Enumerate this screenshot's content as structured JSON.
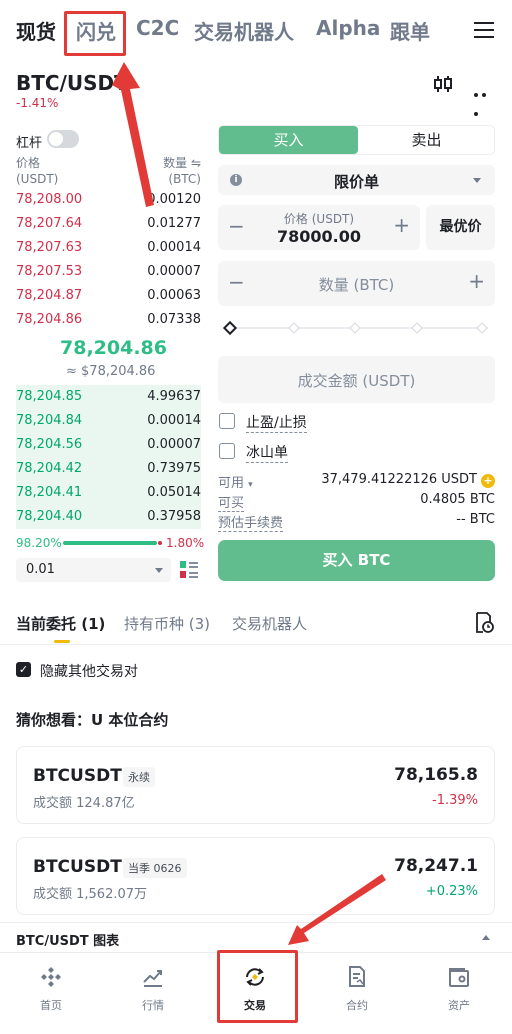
{
  "topnav": {
    "tabs": [
      {
        "label": "现货",
        "active": true
      },
      {
        "label": "闪兑",
        "active": false,
        "highlighted": true
      },
      {
        "label": "C2C",
        "active": false
      },
      {
        "label": "交易机器人",
        "active": false
      },
      {
        "label": "Alpha",
        "active": false
      },
      {
        "label": "跟单",
        "active": false
      }
    ],
    "menu_icon": "hamburger-menu-icon"
  },
  "pair": {
    "symbol": "BTC/USDT",
    "change": "-1.41%",
    "icons": [
      "candlestick-chart-icon",
      "more-dots-icon"
    ]
  },
  "leverage": {
    "label": "杠杆",
    "enabled": false
  },
  "orderbook": {
    "price_header": "价格",
    "price_unit": "(USDT)",
    "qty_header": "数量 ⇋",
    "qty_unit": "(BTC)",
    "asks": [
      {
        "price": "78,208.00",
        "qty": "0.00120",
        "depth": 0.0
      },
      {
        "price": "78,207.64",
        "qty": "0.01277",
        "depth": 0.0
      },
      {
        "price": "78,207.63",
        "qty": "0.00014",
        "depth": 0.0
      },
      {
        "price": "78,207.53",
        "qty": "0.00007",
        "depth": 0.0
      },
      {
        "price": "78,204.87",
        "qty": "0.00063",
        "depth": 0.0
      },
      {
        "price": "78,204.86",
        "qty": "0.07338",
        "depth": 0.0
      }
    ],
    "mid_price": "78,204.86",
    "mid_fiat": "≈ $78,204.86",
    "bids": [
      {
        "price": "78,204.85",
        "qty": "4.99637",
        "depth": 1.0
      },
      {
        "price": "78,204.84",
        "qty": "0.00014",
        "depth": 1.0
      },
      {
        "price": "78,204.56",
        "qty": "0.00007",
        "depth": 1.0
      },
      {
        "price": "78,204.42",
        "qty": "0.73975",
        "depth": 1.0
      },
      {
        "price": "78,204.41",
        "qty": "0.05014",
        "depth": 1.0
      },
      {
        "price": "78,204.40",
        "qty": "0.37958",
        "depth": 1.0
      }
    ],
    "buy_ratio": "98.20%",
    "sell_ratio": "1.80%",
    "precision": "0.01",
    "layout_icon": "orderbook-layout-icon"
  },
  "order_form": {
    "buy_tab": "买入",
    "sell_tab": "卖出",
    "order_type": "限价单",
    "price_label": "价格 (USDT)",
    "price_value": "78000.00",
    "best_price": "最优价",
    "qty_placeholder": "数量 (BTC)",
    "total_placeholder": "成交金额 (USDT)",
    "tp_sl": "止盈/止损",
    "iceberg": "冰山单",
    "available_label": "可用",
    "available_value": "37,479.41222126 USDT",
    "can_buy_label": "可买",
    "can_buy_value": "0.4805 BTC",
    "fee_label": "预估手续费",
    "fee_value": "-- BTC",
    "submit": "买入 BTC"
  },
  "orders": {
    "tabs": [
      "当前委托 (1)",
      "持有币种 (3)",
      "交易机器人"
    ],
    "hide_others": "隐藏其他交易对",
    "guess": "猜你想看：U 本位合约",
    "cards": [
      {
        "symbol": "BTCUSDT",
        "tag": "永续",
        "volume": "成交额 124.87亿",
        "price": "78,165.8",
        "change": "-1.39%",
        "change_color": "#cf304a"
      },
      {
        "symbol": "BTCUSDT",
        "tag": "当季 0626",
        "volume": "成交额 1,562.07万",
        "price": "78,247.1",
        "change": "+0.23%",
        "change_color": "#03a66d"
      }
    ],
    "chart_toggle": "BTC/USDT 图表"
  },
  "bottomnav": [
    {
      "label": "首页",
      "icon": "home-icon",
      "active": false
    },
    {
      "label": "行情",
      "icon": "markets-icon",
      "active": false
    },
    {
      "label": "交易",
      "icon": "trade-icon",
      "active": true
    },
    {
      "label": "合约",
      "icon": "futures-icon",
      "active": false
    },
    {
      "label": "资产",
      "icon": "wallet-icon",
      "active": false
    }
  ],
  "colors": {
    "buy": "#61bd8d",
    "sell": "#cf304a",
    "accent": "#f0b90b",
    "annotation": "#e23a36"
  }
}
